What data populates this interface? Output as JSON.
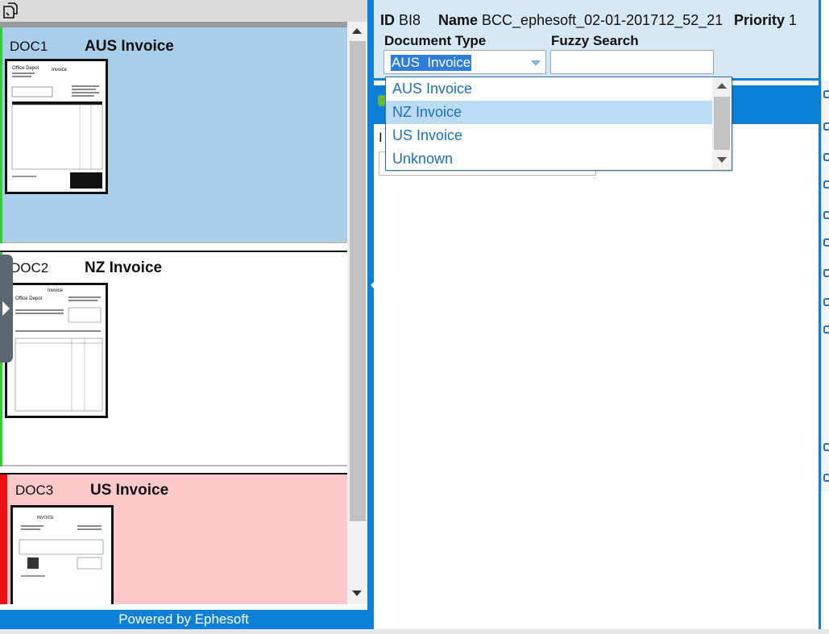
{
  "left_panel": {
    "documents": [
      {
        "id": "DOC1",
        "type": "AUS Invoice",
        "thumb_title": "Invoice",
        "thumb_company": "Office Depot"
      },
      {
        "id": "DOC2",
        "type": "NZ Invoice",
        "thumb_title": "Invoice",
        "thumb_company": "Office Depot"
      },
      {
        "id": "DOC3",
        "type": "US Invoice",
        "thumb_title": "INVOICE",
        "thumb_company": ""
      }
    ],
    "footer": "Powered by Ephesoft"
  },
  "batch": {
    "id_label": "ID",
    "id_value": "BI8",
    "name_label": "Name",
    "name_value": "BCC_ephesoft_02-01-201712_52_21",
    "priority_label": "Priority",
    "priority_value": "1"
  },
  "fields": {
    "document_type_label": "Document Type",
    "document_type_value": "AUS  Invoice",
    "fuzzy_search_label": "Fuzzy Search",
    "fuzzy_search_value": "",
    "partial_label": "I"
  },
  "dropdown": {
    "options": [
      "AUS Invoice",
      "NZ Invoice",
      "US Invoice",
      "Unknown"
    ],
    "highlighted": "NZ Invoice"
  },
  "colors": {
    "accent_blue": "#0c7fd6",
    "doc_selected_bg": "#a9cfeb",
    "doc_error_bg": "#fdc8c9",
    "valid_marker": "#33cc33",
    "error_marker": "#ee1111"
  }
}
